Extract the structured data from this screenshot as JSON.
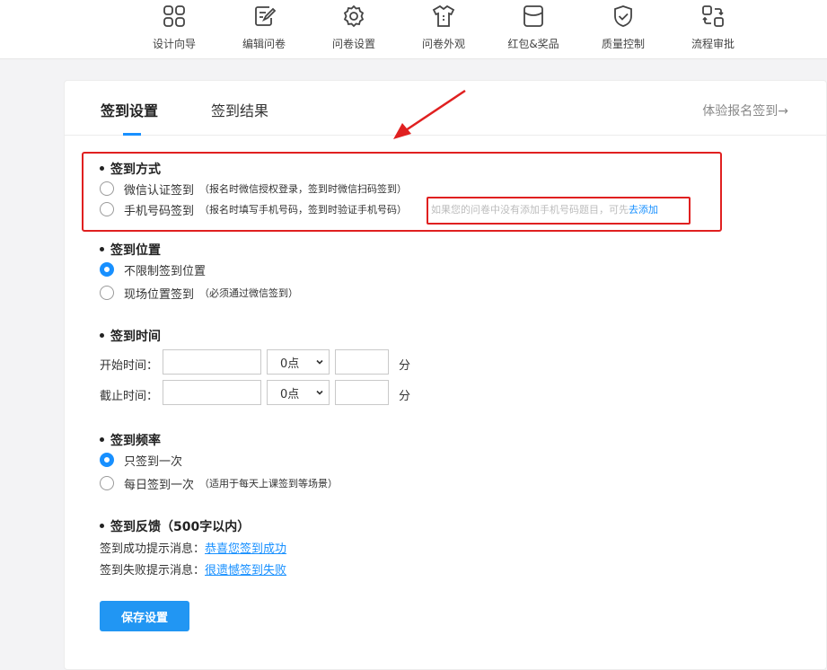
{
  "nav": {
    "items": [
      {
        "label": "设计向导",
        "icon": "grid-icon"
      },
      {
        "label": "编辑问卷",
        "icon": "edit-icon"
      },
      {
        "label": "问卷设置",
        "icon": "gear-icon"
      },
      {
        "label": "问卷外观",
        "icon": "shirt-icon"
      },
      {
        "label": "红包&奖品",
        "icon": "envelope-icon"
      },
      {
        "label": "质量控制",
        "icon": "shield-check-icon"
      },
      {
        "label": "流程审批",
        "icon": "workflow-icon"
      }
    ]
  },
  "tabs": {
    "active": "签到设置",
    "second": "签到结果",
    "trial_link": "体验报名签到→"
  },
  "method": {
    "title": "签到方式",
    "options": [
      {
        "label": "微信认证签到",
        "note": "（报名时微信授权登录，签到时微信扫码签到）",
        "checked": false
      },
      {
        "label": "手机号码签到",
        "note": "（报名时填写手机号码，签到时验证手机号码）",
        "checked": false
      }
    ],
    "hint_text": "如果您的问卷中没有添加手机号码题目，可先",
    "hint_link": "去添加"
  },
  "location": {
    "title": "签到位置",
    "options": [
      {
        "label": "不限制签到位置",
        "note": "",
        "checked": true
      },
      {
        "label": "现场位置签到",
        "note": "（必须通过微信签到）",
        "checked": false
      }
    ]
  },
  "time": {
    "title": "签到时间",
    "start_label": "开始时间：",
    "end_label": "截止时间：",
    "start_date": "",
    "end_date": "",
    "start_hour": "0点",
    "end_hour": "0点",
    "start_minute": "",
    "end_minute": "",
    "minute_unit": "分"
  },
  "frequency": {
    "title": "签到频率",
    "options": [
      {
        "label": "只签到一次",
        "note": "",
        "checked": true
      },
      {
        "label": "每日签到一次",
        "note": "（适用于每天上课签到等场景）",
        "checked": false
      }
    ]
  },
  "feedback": {
    "title": "签到反馈（500字以内）",
    "success_label": "签到成功提示消息：",
    "success_link": "恭喜您签到成功",
    "fail_label": "签到失败提示消息：",
    "fail_link": "很遗憾签到失败"
  },
  "save_button": "保存设置",
  "colors": {
    "accent": "#1890ff",
    "annotation": "#e02020"
  }
}
